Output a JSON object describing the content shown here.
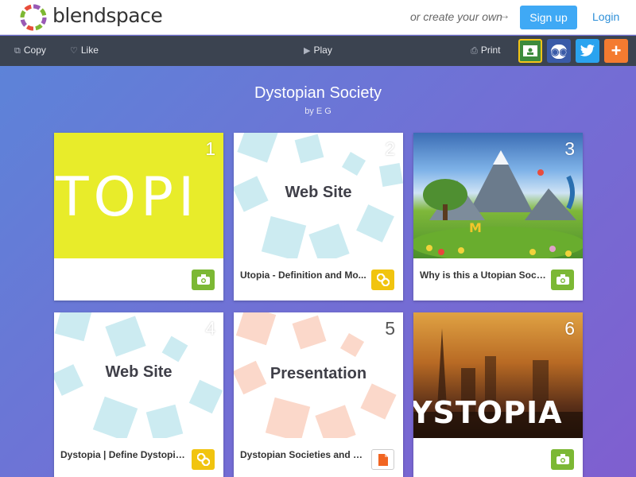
{
  "header": {
    "logo_text": "blendspace",
    "create_text": "or create your own",
    "signup_label": "Sign up",
    "login_label": "Login"
  },
  "toolbar": {
    "copy_label": "Copy",
    "like_label": "Like",
    "play_label": "Play",
    "print_label": "Print",
    "share": [
      {
        "name": "google-classroom",
        "color": "#f5c518"
      },
      {
        "name": "edmodo",
        "color": "#3a5ba8"
      },
      {
        "name": "twitter",
        "color": "#2aa3ef"
      },
      {
        "name": "add-more",
        "color": "#f47b30"
      }
    ]
  },
  "lesson": {
    "title": "Dystopian Society",
    "byline": "by E G"
  },
  "cards": [
    {
      "number": "1",
      "thumb_text": "TOPI",
      "caption": "",
      "badge": "camera-icon"
    },
    {
      "number": "2",
      "thumb_text": "Web Site",
      "caption": "Utopia - Definition and Mo...",
      "badge": "link-icon"
    },
    {
      "number": "3",
      "thumb_text": "",
      "caption": "Why is this a Utopian Soci...",
      "badge": "camera-icon"
    },
    {
      "number": "4",
      "thumb_text": "Web Site",
      "caption": "Dystopia | Define Dystopia...",
      "badge": "link-icon"
    },
    {
      "number": "5",
      "thumb_text": "Presentation",
      "caption": "Dystopian Societies and C...",
      "badge": "document-icon"
    },
    {
      "number": "6",
      "thumb_text": "YSTOPIA",
      "caption": "",
      "badge": "camera-icon"
    }
  ],
  "colors": {
    "accent": "#3fa9f5",
    "toolbar": "#3b4350",
    "badge_green": "#7cb834",
    "badge_yellow": "#f1c40f"
  }
}
